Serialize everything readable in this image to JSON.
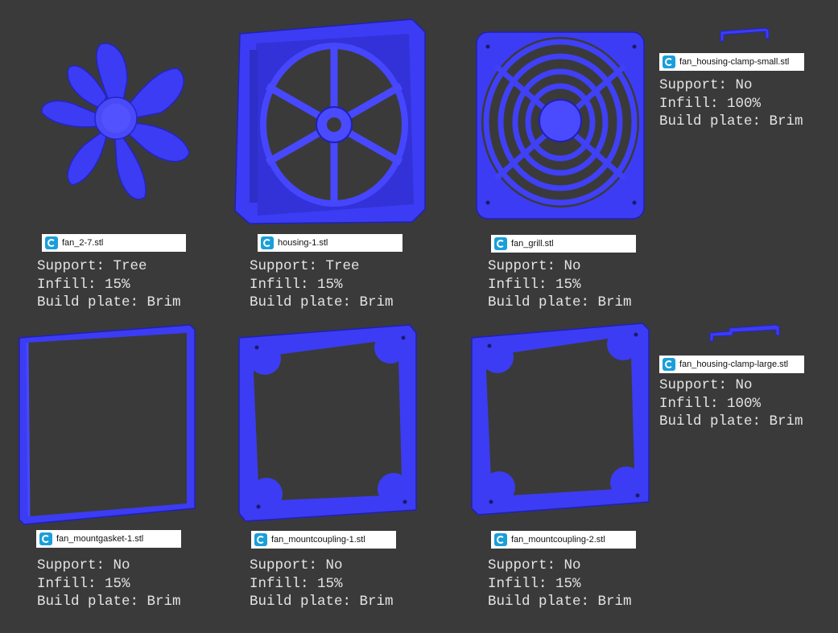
{
  "colors": {
    "background": "#3a3a3a",
    "model": "#3c3cf4",
    "model_dark": "#1f1fb0",
    "model_light": "#6a6aff",
    "label_text": "#e4e4e4",
    "cura_icon": "#1a9fd8"
  },
  "icons": {
    "file_icon": "cura-logo-icon"
  },
  "parts": [
    {
      "file": "fan_2-7.stl",
      "support": "Support: Tree",
      "infill": "Infill: 15%",
      "build_plate": "Build plate: Brim"
    },
    {
      "file": "housing-1.stl",
      "support": "Support: Tree",
      "infill": "Infill: 15%",
      "build_plate": "Build plate: Brim"
    },
    {
      "file": "fan_grill.stl",
      "support": "Support: No",
      "infill": "Infill: 15%",
      "build_plate": "Build plate: Brim"
    },
    {
      "file": "fan_housing-clamp-small.stl",
      "support": "Support: No",
      "infill": "Infill: 100%",
      "build_plate": "Build plate: Brim"
    },
    {
      "file": "fan_mountgasket-1.stl",
      "support": "Support: No",
      "infill": "Infill: 15%",
      "build_plate": "Build plate: Brim"
    },
    {
      "file": "fan_mountcoupling-1.stl",
      "support": "Support: No",
      "infill": "Infill: 15%",
      "build_plate": "Build plate: Brim"
    },
    {
      "file": "fan_mountcoupling-2.stl",
      "support": "Support: No",
      "infill": "Infill: 15%",
      "build_plate": "Build plate: Brim"
    },
    {
      "file": "fan_housing-clamp-large.stl",
      "support": "Support: No",
      "infill": "Infill: 100%",
      "build_plate": "Build plate: Brim"
    }
  ]
}
